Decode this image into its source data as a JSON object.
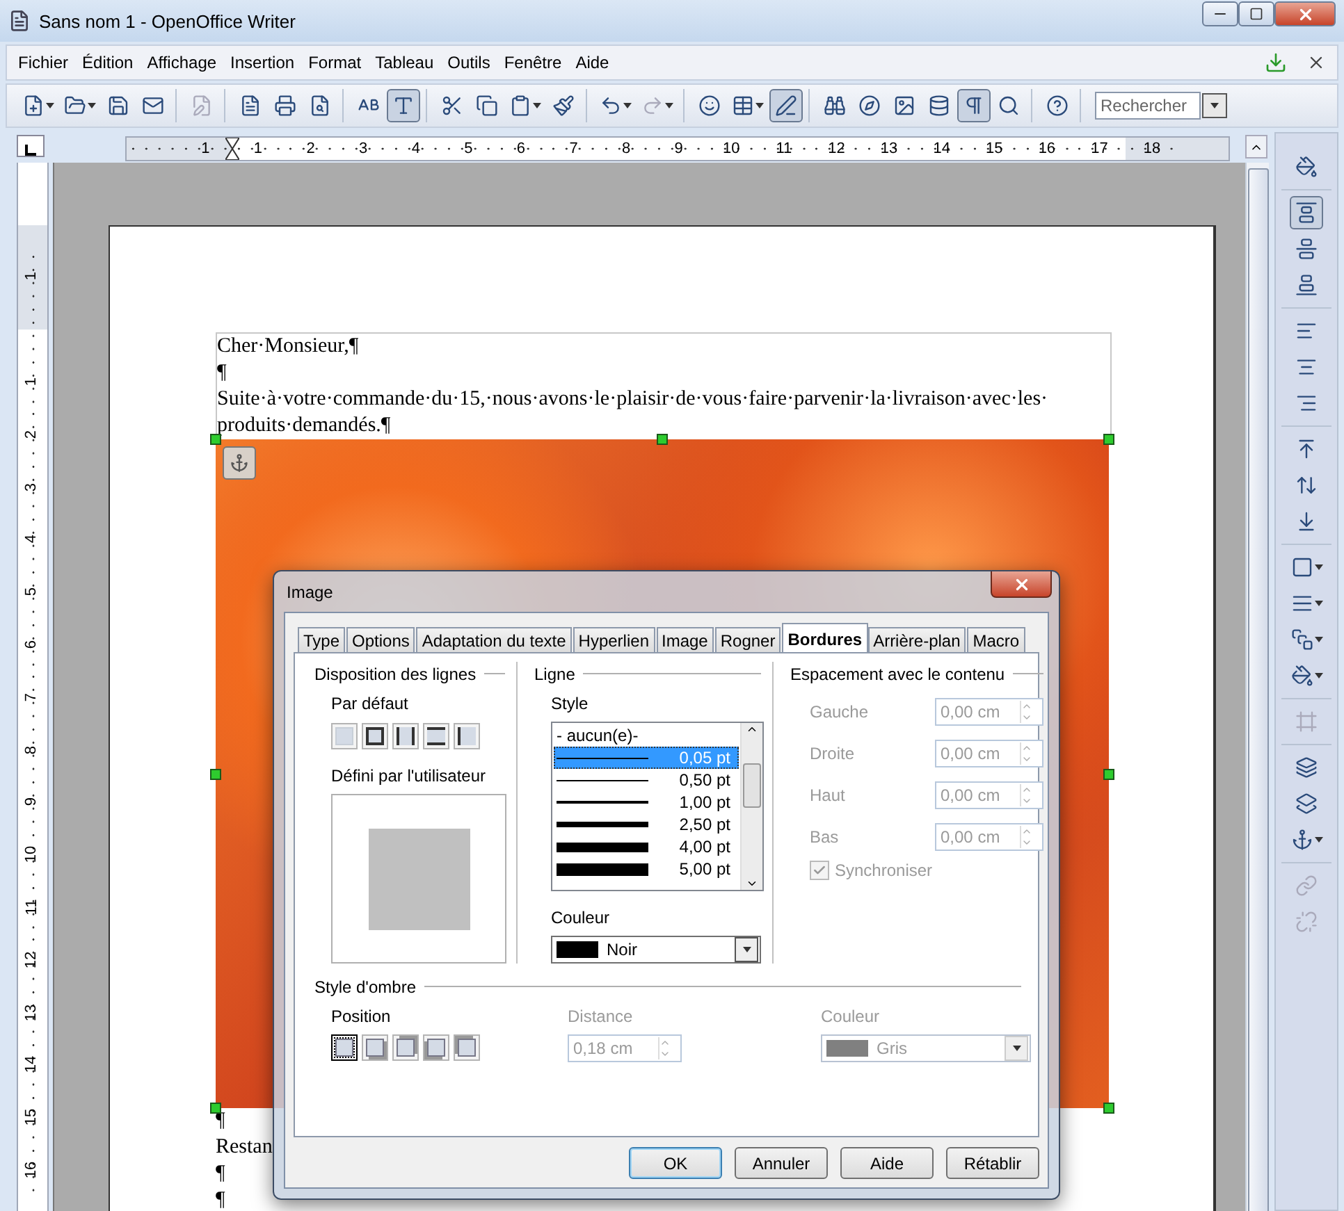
{
  "window": {
    "title": "Sans nom 1 - OpenOffice Writer"
  },
  "menu": [
    "Fichier",
    "Édition",
    "Affichage",
    "Insertion",
    "Format",
    "Tableau",
    "Outils",
    "Fenêtre",
    "Aide"
  ],
  "toolbar": {
    "groups": [
      [
        {
          "pressed": false,
          "disabled": false,
          "dropdown": true
        },
        {
          "pressed": false,
          "disabled": false,
          "dropdown": true
        },
        {
          "pressed": false,
          "disabled": false,
          "dropdown": false
        },
        {
          "pressed": false,
          "disabled": false,
          "dropdown": false
        }
      ],
      [
        {
          "pressed": false,
          "disabled": true,
          "dropdown": false
        }
      ],
      [
        {
          "pressed": false,
          "disabled": false,
          "dropdown": false
        },
        {
          "pressed": false,
          "disabled": false,
          "dropdown": false
        },
        {
          "pressed": false,
          "disabled": false,
          "dropdown": false
        }
      ],
      [
        {
          "pressed": false,
          "disabled": false,
          "dropdown": false
        },
        {
          "pressed": true,
          "disabled": false,
          "dropdown": false
        }
      ],
      [
        {
          "pressed": false,
          "disabled": false,
          "dropdown": false
        },
        {
          "pressed": false,
          "disabled": false,
          "dropdown": false
        },
        {
          "pressed": false,
          "disabled": false,
          "dropdown": true
        },
        {
          "pressed": false,
          "disabled": false,
          "dropdown": false
        }
      ],
      [
        {
          "pressed": false,
          "disabled": false,
          "dropdown": true
        },
        {
          "pressed": false,
          "disabled": true,
          "dropdown": true
        }
      ],
      [
        {
          "pressed": false,
          "disabled": false,
          "dropdown": false
        },
        {
          "pressed": false,
          "disabled": false,
          "dropdown": true
        },
        {
          "pressed": true,
          "disabled": false,
          "dropdown": false
        }
      ],
      [
        {
          "pressed": false,
          "disabled": false,
          "dropdown": false
        },
        {
          "pressed": false,
          "disabled": false,
          "dropdown": false
        },
        {
          "pressed": false,
          "disabled": false,
          "dropdown": false
        },
        {
          "pressed": false,
          "disabled": false,
          "dropdown": false
        },
        {
          "pressed": true,
          "disabled": false,
          "dropdown": false
        },
        {
          "pressed": false,
          "disabled": false,
          "dropdown": false
        }
      ],
      [
        {
          "pressed": false,
          "disabled": false,
          "dropdown": false
        }
      ]
    ],
    "search": {
      "placeholder": "Rechercher"
    }
  },
  "horizontal_ruler": [
    "1",
    "1",
    "2",
    "3",
    "4",
    "5",
    "6",
    "7",
    "8",
    "9",
    "10",
    "11",
    "12",
    "13",
    "14",
    "15",
    "16",
    "17",
    "18"
  ],
  "vertical_ruler": [
    "1",
    "1",
    "2",
    "3",
    "4",
    "5",
    "6",
    "7",
    "8",
    "9",
    "10",
    "11",
    "12",
    "13",
    "14",
    "15",
    "16"
  ],
  "document": {
    "paragraphs_above": [
      "Cher·Monsieur,¶",
      "¶",
      "Suite·à·votre·commande·du·15,·nous·avons·le·plaisir·de·vous·faire·parvenir·la·livraison·avec·les·produits·demandés.¶"
    ],
    "paragraphs_below": [
      "¶",
      "Restan",
      "¶",
      "¶"
    ]
  },
  "sidebar": {
    "groups": [
      [
        {
          "pressed": false,
          "disabled": false,
          "dropdown": false
        }
      ],
      [
        {
          "pressed": true,
          "disabled": false,
          "dropdown": false
        },
        {
          "pressed": false,
          "disabled": false,
          "dropdown": false
        },
        {
          "pressed": false,
          "disabled": false,
          "dropdown": false
        }
      ],
      [
        {
          "pressed": false,
          "disabled": false,
          "dropdown": false
        },
        {
          "pressed": false,
          "disabled": false,
          "dropdown": false
        },
        {
          "pressed": false,
          "disabled": false,
          "dropdown": false
        }
      ],
      [
        {
          "pressed": false,
          "disabled": false,
          "dropdown": false
        },
        {
          "pressed": false,
          "disabled": false,
          "dropdown": false
        },
        {
          "pressed": false,
          "disabled": false,
          "dropdown": false
        }
      ],
      [
        {
          "pressed": false,
          "disabled": false,
          "dropdown": true
        },
        {
          "pressed": false,
          "disabled": false,
          "dropdown": true
        },
        {
          "pressed": false,
          "disabled": false,
          "dropdown": true
        },
        {
          "pressed": false,
          "disabled": false,
          "dropdown": true
        }
      ],
      [
        {
          "pressed": false,
          "disabled": true,
          "dropdown": false
        }
      ],
      [
        {
          "pressed": false,
          "disabled": false,
          "dropdown": false
        },
        {
          "pressed": false,
          "disabled": false,
          "dropdown": false
        },
        {
          "pressed": false,
          "disabled": false,
          "dropdown": true
        }
      ],
      [
        {
          "pressed": false,
          "disabled": true,
          "dropdown": false
        },
        {
          "pressed": false,
          "disabled": true,
          "dropdown": false
        }
      ]
    ]
  },
  "dialog": {
    "title": "Image",
    "tabs": [
      {
        "label": "Type",
        "selected": false
      },
      {
        "label": "Options",
        "selected": false
      },
      {
        "label": "Adaptation du texte",
        "selected": false
      },
      {
        "label": "Hyperlien",
        "selected": false
      },
      {
        "label": "Image",
        "selected": false
      },
      {
        "label": "Rogner",
        "selected": false
      },
      {
        "label": "Bordures",
        "selected": true
      },
      {
        "label": "Arrière-plan",
        "selected": false
      },
      {
        "label": "Macro",
        "selected": false
      }
    ],
    "line_arrangement": {
      "heading": "Disposition des lignes",
      "default_label": "Par défaut",
      "presets": [
        {
          "kind": "none"
        },
        {
          "kind": "box"
        },
        {
          "kind": "sides"
        },
        {
          "kind": "topbottom"
        },
        {
          "kind": "left"
        }
      ],
      "user_label": "Défini par l'utilisateur"
    },
    "line": {
      "heading": "Ligne",
      "style_label": "Style",
      "styles": [
        {
          "label": "- aucun(e)-",
          "kind": "none",
          "selected": false
        },
        {
          "label": "0,05 pt",
          "kind": "hair",
          "selected": true
        },
        {
          "label": "0,50 pt",
          "kind": "thin",
          "selected": false
        },
        {
          "label": "1,00 pt",
          "kind": "medium",
          "selected": false
        },
        {
          "label": "2,50 pt",
          "kind": "thick",
          "selected": false
        },
        {
          "label": "4,00 pt",
          "kind": "heavy",
          "selected": false
        },
        {
          "label": "5,00 pt",
          "kind": "heavier",
          "selected": false
        }
      ],
      "color_label": "Couleur",
      "color": {
        "name": "Noir",
        "color": "#000000"
      }
    },
    "spacing": {
      "heading": "Espacement avec le contenu",
      "disabled": true,
      "fields": [
        {
          "label": "Gauche",
          "value": "0,00 cm"
        },
        {
          "label": "Droite",
          "value": "0,00 cm"
        },
        {
          "label": "Haut",
          "value": "0,00 cm"
        },
        {
          "label": "Bas",
          "value": "0,00 cm"
        }
      ],
      "sync": {
        "label": "Synchroniser",
        "checked": true
      }
    },
    "shadow": {
      "heading": "Style d'ombre",
      "position_label": "Position",
      "positions": [
        {
          "kind": "none",
          "selected": true
        },
        {
          "kind": "bottomright",
          "selected": false
        },
        {
          "kind": "topright",
          "selected": false
        },
        {
          "kind": "bottomleft",
          "selected": false
        },
        {
          "kind": "topleft",
          "selected": false
        }
      ],
      "distance": {
        "label": "Distance",
        "value": "0,18 cm",
        "disabled": true
      },
      "color": {
        "label": "Couleur",
        "name": "Gris",
        "color": "#808080",
        "disabled": true
      }
    },
    "buttons": [
      {
        "label": "OK",
        "default": true
      },
      {
        "label": "Annuler",
        "default": false
      },
      {
        "label": "Aide",
        "default": false
      },
      {
        "label": "Rétablir",
        "default": false
      }
    ]
  }
}
